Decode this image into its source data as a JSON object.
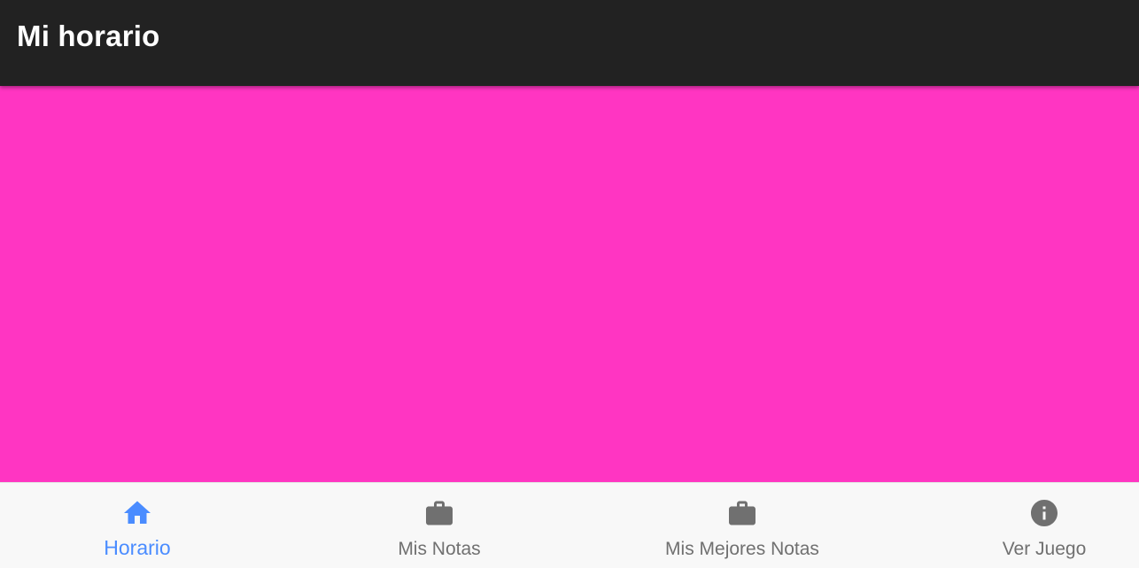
{
  "app_bar": {
    "title": "Mi horario"
  },
  "colors": {
    "app_bar_bg": "#222222",
    "content_bg": "#ff35c2",
    "bottom_nav_bg": "#f8f8f8",
    "active": "#4a8cff",
    "inactive": "#707070"
  },
  "bottom_nav": {
    "items": [
      {
        "label": "Horario",
        "icon": "home-icon",
        "active": true
      },
      {
        "label": "Mis Notas",
        "icon": "briefcase-icon",
        "active": false
      },
      {
        "label": "Mis Mejores Notas",
        "icon": "briefcase-icon",
        "active": false
      },
      {
        "label": "Ver Juego",
        "icon": "info-icon",
        "active": false
      }
    ]
  }
}
